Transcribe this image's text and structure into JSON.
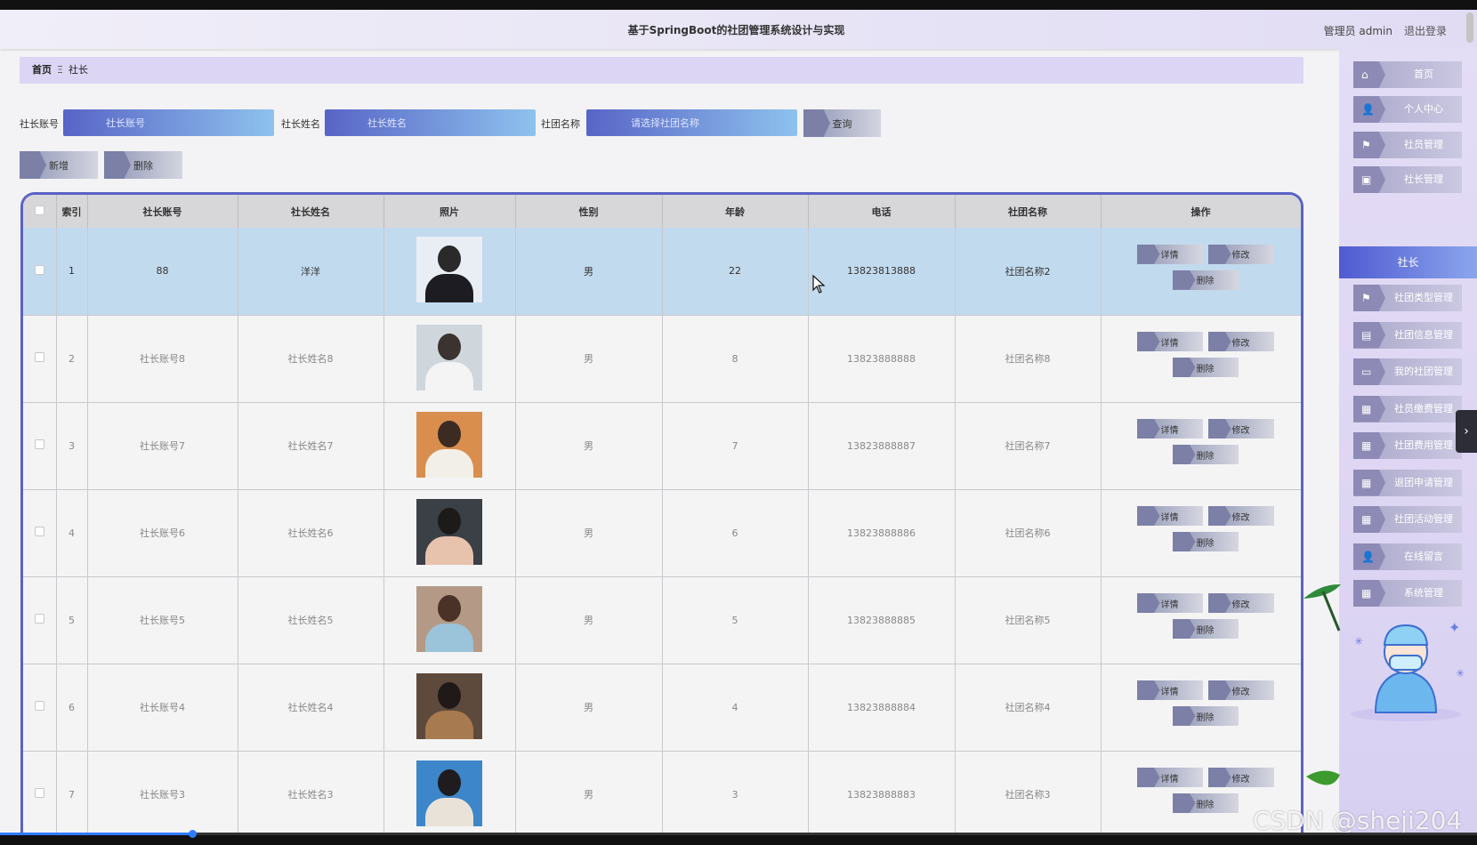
{
  "header": {
    "title": "基于SpringBoot的社团管理系统设计与实现",
    "user": "管理员 admin",
    "logout": "退出登录"
  },
  "breadcrumb": {
    "home": "首页",
    "sep": "Ξ",
    "current": "社长"
  },
  "search": {
    "label1": "社长账号",
    "placeholder1": "社长账号",
    "label2": "社长姓名",
    "placeholder2": "社长姓名",
    "label3": "社团名称",
    "placeholder3": "请选择社团名称",
    "query": "查询"
  },
  "actions": {
    "add": "新增",
    "delete": "删除"
  },
  "table": {
    "headers": [
      "索引",
      "社长账号",
      "社长姓名",
      "照片",
      "性别",
      "年龄",
      "电话",
      "社团名称",
      "操作"
    ],
    "op_detail": "详情",
    "op_edit": "修改",
    "op_delete": "删除",
    "rows": [
      {
        "index": "1",
        "account": "88",
        "name": "洋洋",
        "gender": "男",
        "age": "22",
        "phone": "13823813888",
        "club": "社团名称2",
        "photo_bg": "#e9eef5",
        "photo_head": "#2a2a2a",
        "photo_body": "#1c1c22"
      },
      {
        "index": "2",
        "account": "社长账号8",
        "name": "社长姓名8",
        "gender": "男",
        "age": "8",
        "phone": "13823888888",
        "club": "社团名称8",
        "photo_bg": "#cfd6dc",
        "photo_head": "#3a3330",
        "photo_body": "#f4f4f4"
      },
      {
        "index": "3",
        "account": "社长账号7",
        "name": "社长姓名7",
        "gender": "男",
        "age": "7",
        "phone": "13823888887",
        "club": "社团名称7",
        "photo_bg": "#d98e4e",
        "photo_head": "#3b2b22",
        "photo_body": "#f2efe8"
      },
      {
        "index": "4",
        "account": "社长账号6",
        "name": "社长姓名6",
        "gender": "男",
        "age": "6",
        "phone": "13823888886",
        "club": "社团名称6",
        "photo_bg": "#3b3f46",
        "photo_head": "#1d1a1a",
        "photo_body": "#e7c2ad"
      },
      {
        "index": "5",
        "account": "社长账号5",
        "name": "社长姓名5",
        "gender": "男",
        "age": "5",
        "phone": "13823888885",
        "club": "社团名称5",
        "photo_bg": "#b49a86",
        "photo_head": "#4a3326",
        "photo_body": "#9bc3d9"
      },
      {
        "index": "6",
        "account": "社长账号4",
        "name": "社长姓名4",
        "gender": "男",
        "age": "4",
        "phone": "13823888884",
        "club": "社团名称4",
        "photo_bg": "#5d4a3c",
        "photo_head": "#1f1a17",
        "photo_body": "#a87a4f"
      },
      {
        "index": "7",
        "account": "社长账号3",
        "name": "社长姓名3",
        "gender": "男",
        "age": "3",
        "phone": "13823888883",
        "club": "社团名称3",
        "photo_bg": "#3c86c9",
        "photo_head": "#1e1c1e",
        "photo_body": "#e9e2d8"
      }
    ]
  },
  "sidebar": {
    "items": [
      "首页",
      "个人中心",
      "社员管理",
      "社长管理"
    ],
    "active": "社长",
    "items2": [
      "社团类型管理",
      "社团信息管理",
      "我的社团管理",
      "社员缴费管理",
      "社团费用管理",
      "退团申请管理",
      "社团活动管理",
      "在线留言",
      "系统管理"
    ],
    "icons": [
      "⌂",
      "👤",
      "⚑",
      "▣",
      "⚑",
      "▤",
      "▭",
      "▦",
      "▦",
      "▦",
      "▦",
      "👤",
      "▦"
    ]
  },
  "progress": {
    "percent": 13
  },
  "watermark": "CSDN @sheji204"
}
